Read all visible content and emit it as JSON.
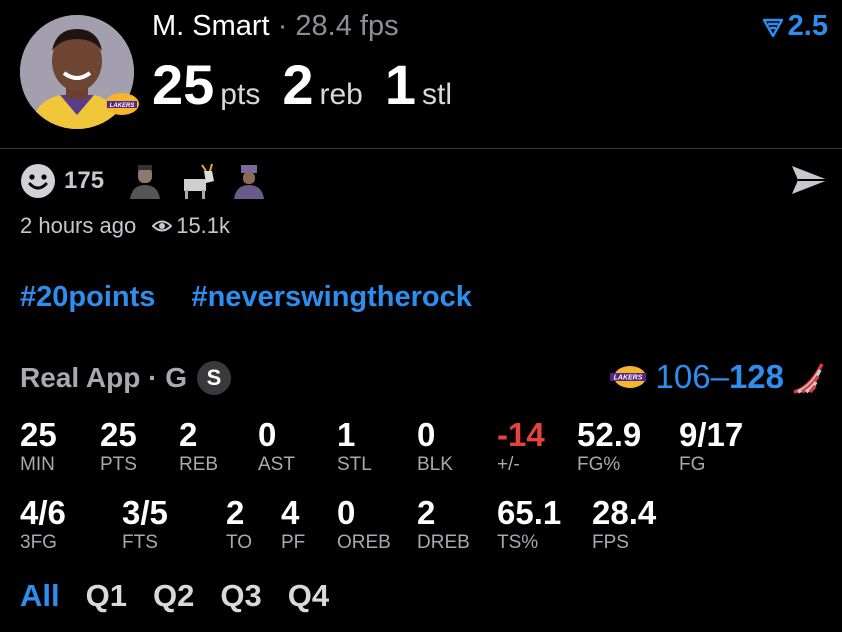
{
  "player": {
    "name": "M. Smart",
    "separator": "·",
    "fps": "28.4 fps",
    "boost": "2.5"
  },
  "statline": [
    {
      "num": "25",
      "unit": "pts"
    },
    {
      "num": "2",
      "unit": "reb"
    },
    {
      "num": "1",
      "unit": "stl"
    }
  ],
  "reactions": {
    "count": "175"
  },
  "meta": {
    "time": "2 hours ago",
    "views": "15.1k"
  },
  "tags": [
    "#20points",
    "#neverswingtherock"
  ],
  "game": {
    "source": "Real App · G",
    "badge": "S",
    "team_score": "106",
    "dash": "–",
    "opp_score": "128"
  },
  "stats_row1": [
    {
      "v": "25",
      "l": "MIN"
    },
    {
      "v": "25",
      "l": "PTS"
    },
    {
      "v": "2",
      "l": "REB"
    },
    {
      "v": "0",
      "l": "AST"
    },
    {
      "v": "1",
      "l": "STL"
    },
    {
      "v": "0",
      "l": "BLK"
    },
    {
      "v": "-14",
      "l": "+/-"
    },
    {
      "v": "52.9",
      "l": "FG%"
    },
    {
      "v": "9/17",
      "l": "FG"
    }
  ],
  "stats_row2": [
    {
      "v": "4/6",
      "l": "3FG"
    },
    {
      "v": "3/5",
      "l": "FTS"
    },
    {
      "v": "2",
      "l": "TO"
    },
    {
      "v": "4",
      "l": "PF"
    },
    {
      "v": "0",
      "l": "OREB"
    },
    {
      "v": "2",
      "l": "DREB"
    },
    {
      "v": "65.1",
      "l": "TS%"
    },
    {
      "v": "28.4",
      "l": "FPS"
    }
  ],
  "tabs": [
    "All",
    "Q1",
    "Q2",
    "Q3",
    "Q4"
  ],
  "colors": {
    "accent": "#2e8ef0",
    "negative": "#e5433e",
    "muted": "#a9a9ae"
  },
  "icons": [
    "boost-icon",
    "smiley-icon",
    "eye-icon",
    "send-icon",
    "lakers-logo",
    "blazers-logo"
  ]
}
